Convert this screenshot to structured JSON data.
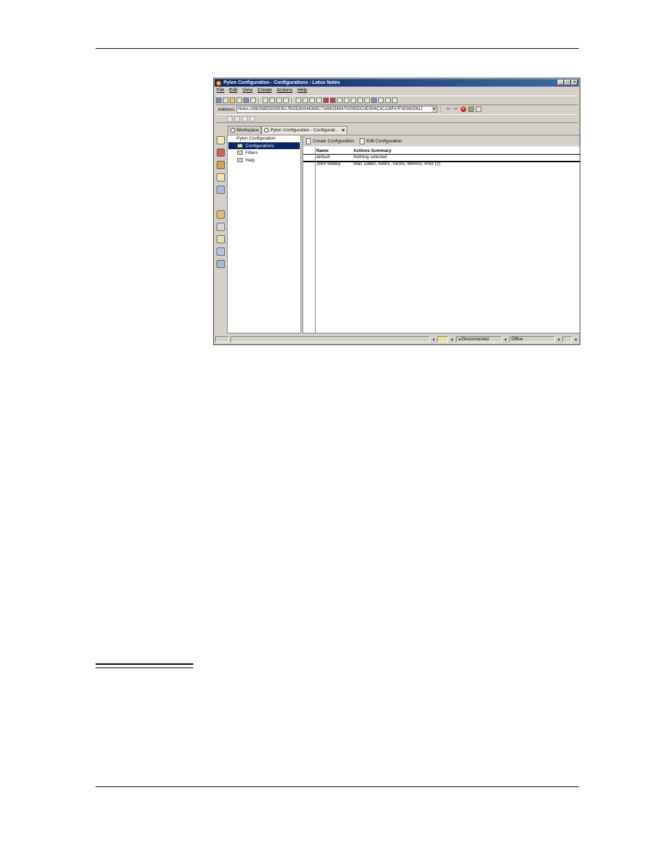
{
  "window": {
    "title": "Pylon Configuration - Configurations - Lotus Notes",
    "min": "_",
    "max": "□",
    "close": "×"
  },
  "menu": [
    "File",
    "Edit",
    "View",
    "Create",
    "Actions",
    "Help"
  ],
  "address": {
    "label": "Address",
    "value": "Notes:///88256EDD0053517B/DD80046385C7188625694700095DC0E/904C3C128FA7F0D9825612"
  },
  "tabs": {
    "workspace": "Workspace",
    "current": "Pylon Configuration - Configurati..."
  },
  "navigator": {
    "title": "Pylon Configuration",
    "items": [
      "Configurations",
      "Filters",
      "Help"
    ]
  },
  "actions": {
    "create": "Create Configuration",
    "edit": "Edit Configuration"
  },
  "view": {
    "columns": [
      "Name",
      "Actions Summary"
    ],
    "rows": [
      {
        "name": "default",
        "summary": "Nothing selected"
      },
      {
        "name": "John Walley",
        "summary": "Mail, Dates, Addrs, ToDos, Memos, Pros (2)"
      }
    ]
  },
  "status": {
    "connection": "Disconnected",
    "location": "Office"
  }
}
